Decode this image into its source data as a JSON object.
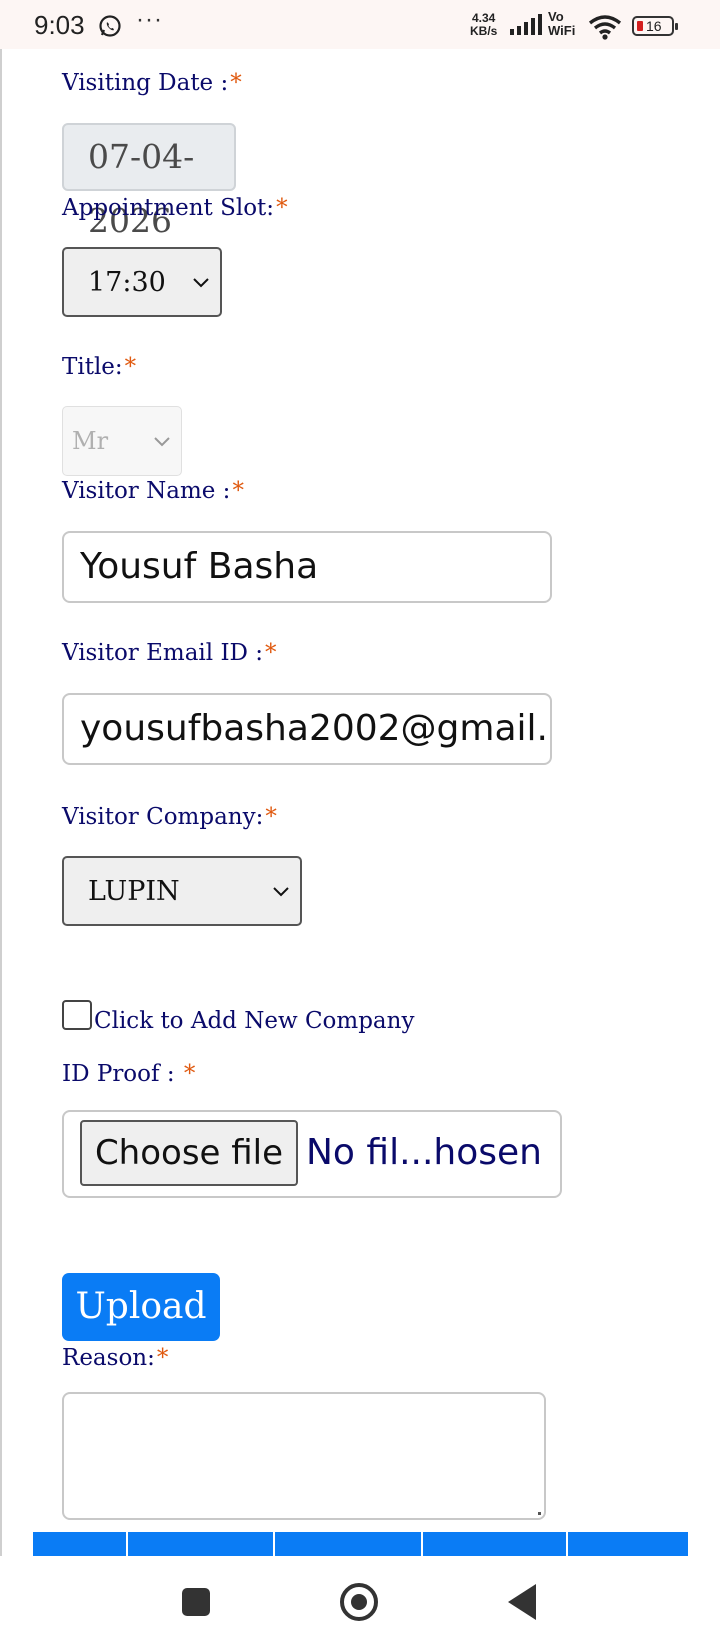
{
  "status_bar": {
    "time": "9:03",
    "more_dots": "···",
    "speed_value": "4.34",
    "speed_unit": "KB/s",
    "vo_label": "Vo",
    "wifi_label": "WiFi",
    "battery_level": "16"
  },
  "form": {
    "visiting_date": {
      "label": "Visiting Date :",
      "value": "07-04-2026"
    },
    "appointment_slot": {
      "label": "Appointment Slot:",
      "value": "17:30"
    },
    "title": {
      "label": "Title:",
      "value": "Mr"
    },
    "visitor_name": {
      "label": "Visitor Name :",
      "value": "Yousuf Basha"
    },
    "visitor_email": {
      "label": "Visitor Email ID :",
      "value": "yousufbasha2002@gmail.c"
    },
    "visitor_company": {
      "label": "Visitor Company:",
      "value": "LUPIN"
    },
    "add_company_checkbox": {
      "label": "Click to Add New Company",
      "checked": false
    },
    "id_proof": {
      "label": "ID Proof : ",
      "button_label": "Choose file",
      "status": "No fil...hosen"
    },
    "upload_button": "Upload",
    "reason": {
      "label": "Reason:",
      "value": ""
    },
    "required_mark": "*"
  },
  "colors": {
    "label_text": "#0a0a6a",
    "required_mark": "#e05a10",
    "primary_button": "#0a7cf5"
  },
  "nav_bar": {
    "icons": [
      "recent-apps-icon",
      "home-icon",
      "back-icon"
    ]
  }
}
